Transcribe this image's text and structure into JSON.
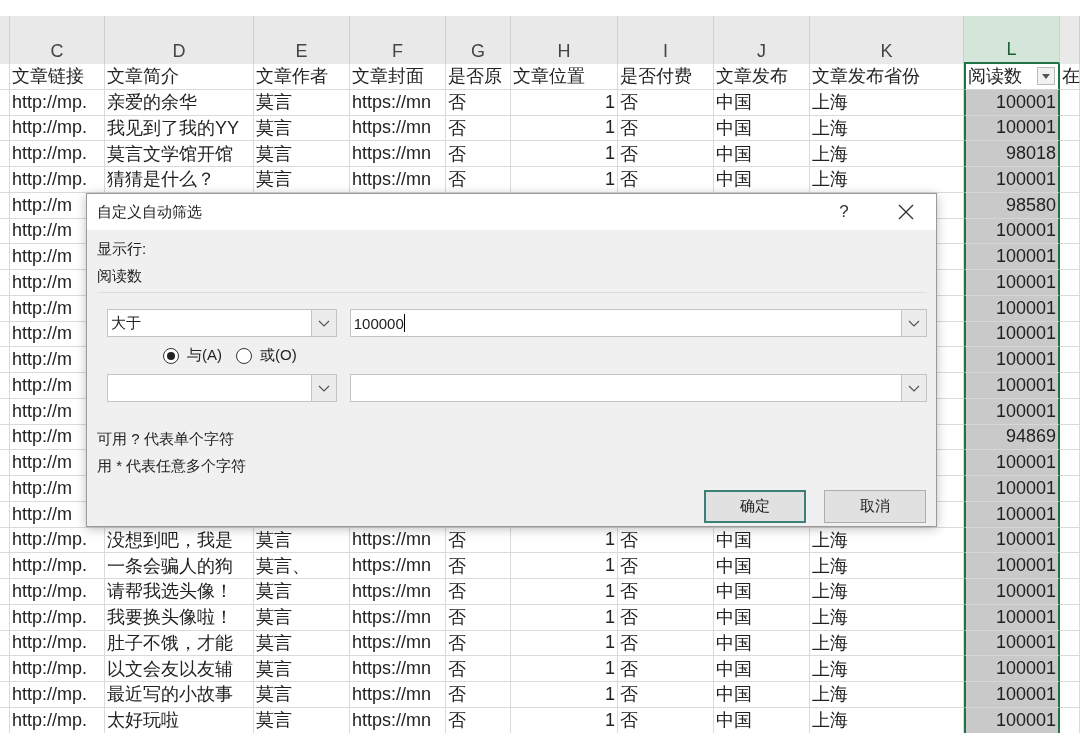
{
  "columns": [
    {
      "letter": "C",
      "selected": false,
      "numeric": false,
      "filter_button": false
    },
    {
      "letter": "D",
      "selected": false,
      "numeric": false,
      "filter_button": false
    },
    {
      "letter": "E",
      "selected": false,
      "numeric": false,
      "filter_button": false
    },
    {
      "letter": "F",
      "selected": false,
      "numeric": false,
      "filter_button": false
    },
    {
      "letter": "G",
      "selected": false,
      "numeric": false,
      "filter_button": false
    },
    {
      "letter": "H",
      "selected": false,
      "numeric": true,
      "filter_button": false
    },
    {
      "letter": "I",
      "selected": false,
      "numeric": false,
      "filter_button": false
    },
    {
      "letter": "J",
      "selected": false,
      "numeric": false,
      "filter_button": false
    },
    {
      "letter": "K",
      "selected": false,
      "numeric": false,
      "filter_button": false
    },
    {
      "letter": "L",
      "selected": true,
      "numeric": true,
      "filter_button": true
    }
  ],
  "header": {
    "C": "文章链接",
    "D": "文章简介",
    "E": "文章作者",
    "F": "文章封面",
    "G": "是否原",
    "H": "文章位置",
    "I": "是否付费",
    "J": "文章发布",
    "K": "文章发布省份",
    "L": "阅读数",
    "M": "在"
  },
  "rows": [
    {
      "C": "http://mp.",
      "D": "亲爱的余华",
      "E": "莫言",
      "F": "https://mn",
      "G": "否",
      "H": "1",
      "I": "否",
      "J": "中国",
      "K": "上海",
      "L": "100001"
    },
    {
      "C": "http://mp.",
      "D": "我见到了我的YY",
      "E": "莫言",
      "F": "https://mn",
      "G": "否",
      "H": "1",
      "I": "否",
      "J": "中国",
      "K": "上海",
      "L": "100001"
    },
    {
      "C": "http://mp.",
      "D": "莫言文学馆开馆",
      "E": "莫言",
      "F": "https://mn",
      "G": "否",
      "H": "1",
      "I": "否",
      "J": "中国",
      "K": "上海",
      "L": "98018"
    },
    {
      "C": "http://mp.",
      "D": "猜猜是什么？",
      "E": "莫言",
      "F": "https://mn",
      "G": "否",
      "H": "1",
      "I": "否",
      "J": "中国",
      "K": "上海",
      "L": "100001"
    },
    {
      "C": "http://m",
      "L": "98580"
    },
    {
      "C": "http://m",
      "L": "100001"
    },
    {
      "C": "http://m",
      "L": "100001"
    },
    {
      "C": "http://m",
      "L": "100001"
    },
    {
      "C": "http://m",
      "L": "100001"
    },
    {
      "C": "http://m",
      "L": "100001"
    },
    {
      "C": "http://m",
      "L": "100001"
    },
    {
      "C": "http://m",
      "L": "100001"
    },
    {
      "C": "http://m",
      "L": "100001"
    },
    {
      "C": "http://m",
      "L": "94869"
    },
    {
      "C": "http://m",
      "L": "100001"
    },
    {
      "C": "http://m",
      "L": "100001"
    },
    {
      "C": "http://m",
      "L": "100001"
    },
    {
      "C": "http://mp.",
      "D": "没想到吧，我是",
      "E": "莫言",
      "F": "https://mn",
      "G": "否",
      "H": "1",
      "I": "否",
      "J": "中国",
      "K": "上海",
      "L": "100001"
    },
    {
      "C": "http://mp.",
      "D": "一条会骗人的狗",
      "E": "莫言、",
      "F": "https://mn",
      "G": "否",
      "H": "1",
      "I": "否",
      "J": "中国",
      "K": "上海",
      "L": "100001"
    },
    {
      "C": "http://mp.",
      "D": "请帮我选头像！",
      "E": "莫言",
      "F": "https://mn",
      "G": "否",
      "H": "1",
      "I": "否",
      "J": "中国",
      "K": "上海",
      "L": "100001"
    },
    {
      "C": "http://mp.",
      "D": "我要换头像啦！",
      "E": "莫言",
      "F": "https://mn",
      "G": "否",
      "H": "1",
      "I": "否",
      "J": "中国",
      "K": "上海",
      "L": "100001"
    },
    {
      "C": "http://mp.",
      "D": "肚子不饿，才能",
      "E": "莫言",
      "F": "https://mn",
      "G": "否",
      "H": "1",
      "I": "否",
      "J": "中国",
      "K": "上海",
      "L": "100001"
    },
    {
      "C": "http://mp.",
      "D": "以文会友以友辅",
      "E": "莫言",
      "F": "https://mn",
      "G": "否",
      "H": "1",
      "I": "否",
      "J": "中国",
      "K": "上海",
      "L": "100001"
    },
    {
      "C": "http://mp.",
      "D": "最近写的小故事",
      "E": "莫言",
      "F": "https://mn",
      "G": "否",
      "H": "1",
      "I": "否",
      "J": "中国",
      "K": "上海",
      "L": "100001"
    },
    {
      "C": "http://mp.",
      "D": "太好玩啦",
      "E": "莫言",
      "F": "https://mn",
      "G": "否",
      "H": "1",
      "I": "否",
      "J": "中国",
      "K": "上海",
      "L": "100001"
    }
  ],
  "dialog": {
    "title": "自定义自动筛选",
    "help": "?",
    "section_label": "显示行:",
    "field_name": "阅读数",
    "conditions": [
      {
        "operator": "大于",
        "value": "100000",
        "focused": true
      },
      {
        "focused": false
      }
    ],
    "joins": [
      {
        "label": "与(A)",
        "selected": true
      },
      {
        "label": "或(O)",
        "selected": false
      }
    ],
    "hints": [
      "可用 ? 代表单个字符",
      "用 * 代表任意多个字符"
    ],
    "buttons": [
      {
        "label": "确定",
        "default": true
      },
      {
        "label": "取消",
        "default": false
      }
    ]
  }
}
